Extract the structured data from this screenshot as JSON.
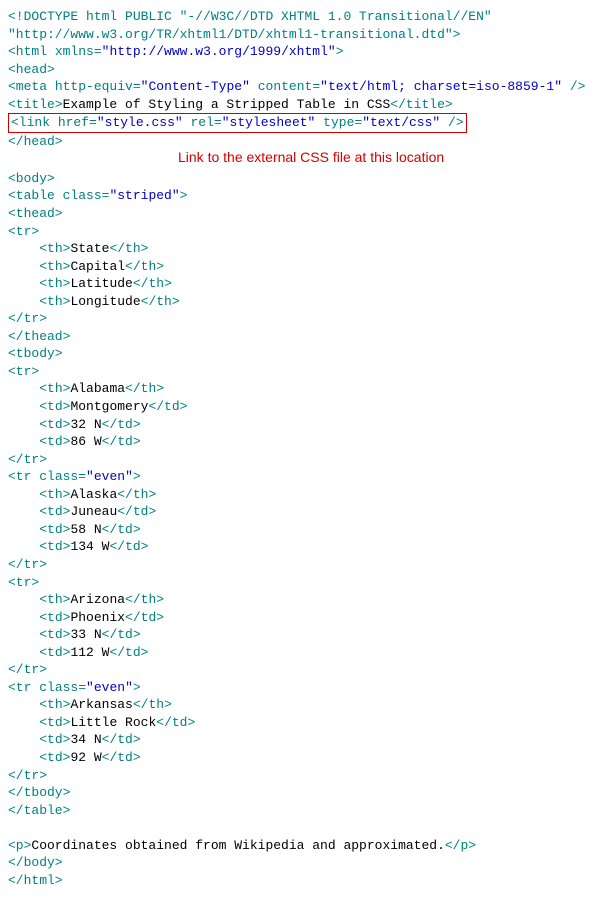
{
  "doctype_line1": "<!DOCTYPE html PUBLIC \"-//W3C//DTD XHTML 1.0 Transitional//EN\"",
  "doctype_line2": "\"http://www.w3.org/TR/xhtml1/DTD/xhtml1-transitional.dtd\">",
  "xmlns": "http://www.w3.org/1999/xhtml",
  "meta": {
    "http_equiv": "Content-Type",
    "content": "text/html; charset=iso-8859-1"
  },
  "title_text": "Example of Styling a Stripped Table in CSS",
  "link": {
    "href": "style.css",
    "rel": "stylesheet",
    "type": "text/css"
  },
  "annotation": "Link to the external CSS file at this location",
  "table_class": "striped",
  "headers": [
    "State",
    "Capital",
    "Latitude",
    "Longitude"
  ],
  "rows": [
    {
      "class": "",
      "state": "Alabama",
      "capital": "Montgomery",
      "lat": "32 N",
      "lon": "86 W"
    },
    {
      "class": "even",
      "state": "Alaska",
      "capital": "Juneau",
      "lat": "58 N",
      "lon": "134 W"
    },
    {
      "class": "",
      "state": "Arizona",
      "capital": "Phoenix",
      "lat": "33 N",
      "lon": "112 W"
    },
    {
      "class": "even",
      "state": "Arkansas",
      "capital": "Little Rock",
      "lat": "34 N",
      "lon": "92 W"
    }
  ],
  "footer_text": "Coordinates obtained from Wikipedia and approximated."
}
